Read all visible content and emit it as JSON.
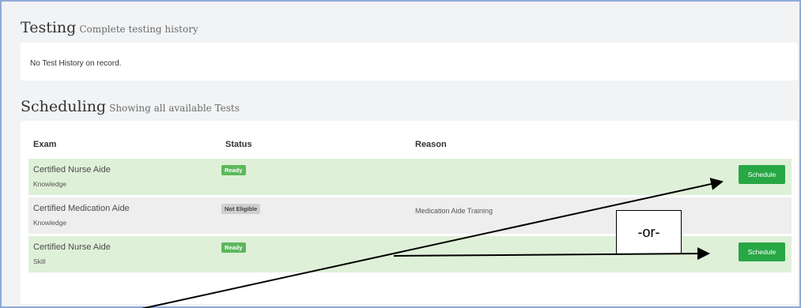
{
  "testing": {
    "title": "Testing",
    "subtitle": "Complete testing history",
    "empty_message": "No Test History on record."
  },
  "scheduling": {
    "title": "Scheduling",
    "subtitle": "Showing all available Tests",
    "columns": {
      "exam": "Exam",
      "status": "Status",
      "reason": "Reason"
    },
    "rows": [
      {
        "exam": "Certified Nurse Aide",
        "type": "Knowledge",
        "status": "Ready",
        "reason": "",
        "action": "Schedule",
        "row_color": "#dff0d8"
      },
      {
        "exam": "Certified Medication Aide",
        "type": "Knowledge",
        "status": "Not Eligible",
        "reason": "Medication Aide Training",
        "action": "",
        "row_color": "#eeeeee"
      },
      {
        "exam": "Certified Nurse Aide",
        "type": "Skill",
        "status": "Ready",
        "reason": "",
        "action": "Schedule",
        "row_color": "#dff0d8"
      }
    ]
  },
  "annotation": {
    "label": "-or-"
  },
  "colors": {
    "ready_badge": "#5cb85c",
    "schedule_button": "#28a745",
    "frame_border": "#8eaad8"
  }
}
